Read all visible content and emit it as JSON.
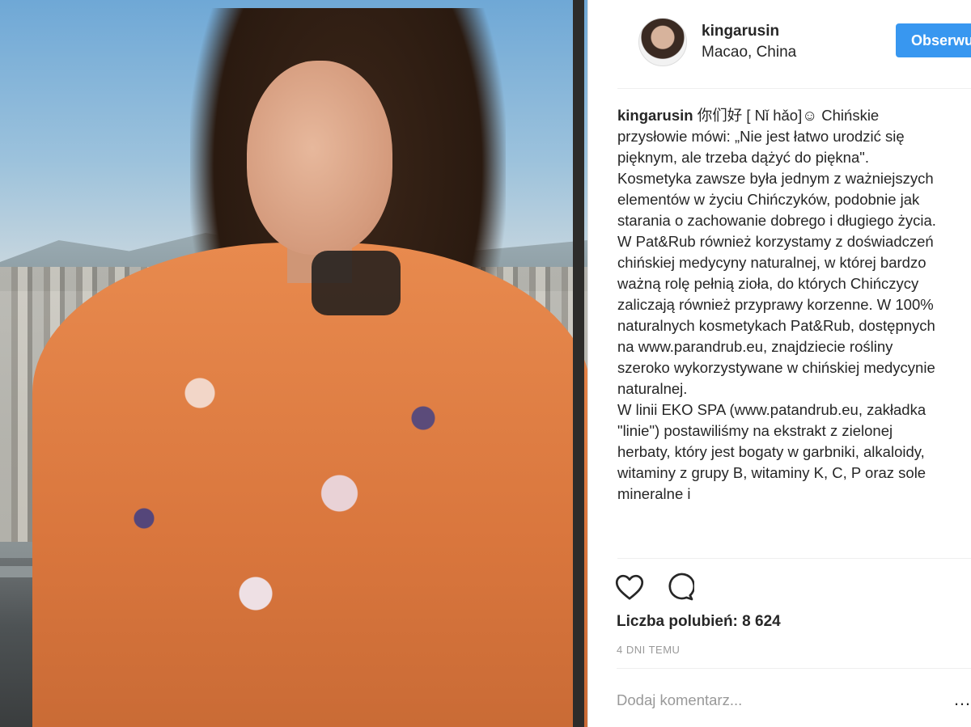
{
  "post": {
    "username": "kingarusin",
    "location": "Macao, China",
    "follow_label": "Obserwuj",
    "caption_user": "kingarusin",
    "caption_text": " 你们好 [ Nǐ hǎo]☺ Chińskie przysłowie mówi: „Nie jest łatwo urodzić się pięknym, ale trzeba dążyć do piękna\". Kosmetyka zawsze była jednym z ważniejszych elementów w życiu Chińczyków, podobnie jak starania o zachowanie dobrego i długiego życia. W Pat&Rub również korzystamy z doświadczeń chińskiej medycyny naturalnej, w której bardzo ważną rolę pełnią zioła, do których Chińczycy zaliczają również przyprawy korzenne. W 100% naturalnych kosmetykach Pat&Rub, dostępnych na www.parandrub.eu, znajdziecie rośliny szeroko wykorzystywane w chińskiej medycynie naturalnej.\nW linii EKO SPA (www.patandrub.eu, zakładka \"linie\") postawiliśmy na ekstrakt z zielonej herbaty, który jest bogaty w garbniki, alkaloidy, witaminy z grupy B, witaminy K, C, P oraz sole mineralne i",
    "likes": "Liczba polubień: 8 624",
    "timestamp": "4 DNI TEMU",
    "comment_placeholder": "Dodaj komentarz...",
    "more_label": "…"
  },
  "icons": {
    "like": "heart-icon",
    "comment": "comment-icon",
    "more": "more-options-icon"
  },
  "colors": {
    "follow_button": "#3897f0",
    "text": "#262626",
    "muted": "#999999"
  }
}
